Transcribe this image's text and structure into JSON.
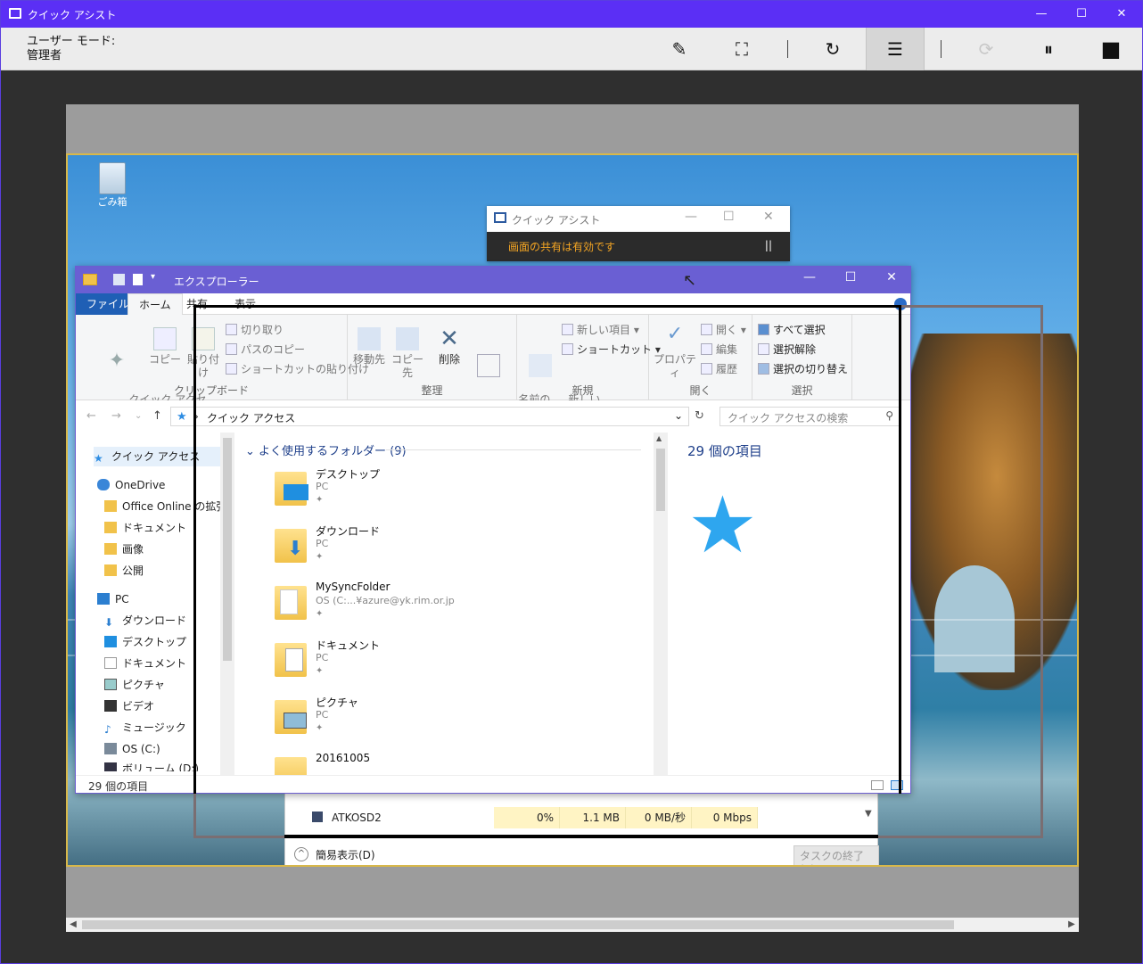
{
  "app": {
    "title": "クイック アシスト",
    "window_controls": {
      "minimize": "—",
      "maximize": "☐",
      "close": "✕"
    }
  },
  "toolbar": {
    "mode_label": "ユーザー モード:",
    "mode_value": "管理者",
    "buttons": {
      "annotate": "✎",
      "fit": "⛶",
      "restart": "↻",
      "task_manager": "☰",
      "reconnect": "⟳",
      "pause": "⏸",
      "stop": "■"
    }
  },
  "remote": {
    "share_window": {
      "title": "クイック アシスト",
      "status": "画面の共有は有効です",
      "pause": "||",
      "controls": {
        "minimize": "—",
        "maximize": "☐",
        "close": "✕"
      }
    },
    "recycle_bin_label": "ごみ箱",
    "explorer": {
      "title": "エクスプローラー",
      "window_controls": {
        "minimize": "—",
        "maximize": "☐",
        "close": "✕"
      },
      "tabs": [
        "ファイル",
        "ホーム",
        "共有",
        "表示"
      ],
      "ribbon": {
        "clipboard": {
          "label": "クリップボード",
          "pin": "クイック アクセ\nスにピン留め",
          "copy": "コピー",
          "paste": "貼り付け",
          "cut": "切り取り",
          "copy_path": "パスのコピー",
          "paste_shortcut": "ショートカットの貼り付け"
        },
        "organize": {
          "label": "整理",
          "move_to": "移動先",
          "copy_to": "コピー先",
          "delete": "削除",
          "rename": "名前の\n変更"
        },
        "new": {
          "label": "新規",
          "new_folder": "新しい\nフォルダー",
          "new_item": "新しい項目",
          "shortcut": "ショートカット"
        },
        "open": {
          "label": "開く",
          "properties": "プロパティ",
          "open": "開く",
          "edit": "編集",
          "history": "履歴"
        },
        "select": {
          "label": "選択",
          "select_all": "すべて選択",
          "select_none": "選択解除",
          "invert": "選択の切り替え"
        }
      },
      "address": {
        "path": "クイック アクセス",
        "search_placeholder": "クイック アクセスの検索",
        "back": "←",
        "forward": "→",
        "recent": "⌄",
        "up": "↑",
        "refresh": "↻",
        "path_sep": "›"
      },
      "nav_items": [
        "クイック アクセス",
        "OneDrive",
        "Office Online の拡張",
        "ドキュメント",
        "画像",
        "公開",
        "PC",
        "ダウンロード",
        "デスクトップ",
        "ドキュメント",
        "ピクチャ",
        "ビデオ",
        "ミュージック",
        "OS (C:)",
        "ボリューム (D:)"
      ],
      "group_title": "よく使用するフォルダー (9)",
      "folders": [
        {
          "name": "デスクトップ",
          "sub": "PC"
        },
        {
          "name": "ダウンロード",
          "sub": "PC"
        },
        {
          "name": "MySyncFolder",
          "sub": "OS (C:...¥azure@yk.rim.or.jp"
        },
        {
          "name": "ドキュメント",
          "sub": "PC"
        },
        {
          "name": "ピクチャ",
          "sub": "PC"
        },
        {
          "name": "20161005",
          "sub": ""
        }
      ],
      "preview_count": "29 個の項目",
      "status": "29 個の項目"
    },
    "task_manager": {
      "row_name": "ATKOSD2",
      "cpu": "0%",
      "memory": "1.1 MB",
      "disk": "0 MB/秒",
      "network": "0 Mbps",
      "simple_view": "簡易表示(D)",
      "end_task": "タスクの終了(E)"
    }
  },
  "colors": {
    "titlebar": "#5b2ff5",
    "explorer_title": "#6a5fd3",
    "share_status": "#f5a623",
    "desktop_border": "#d8b84a"
  }
}
